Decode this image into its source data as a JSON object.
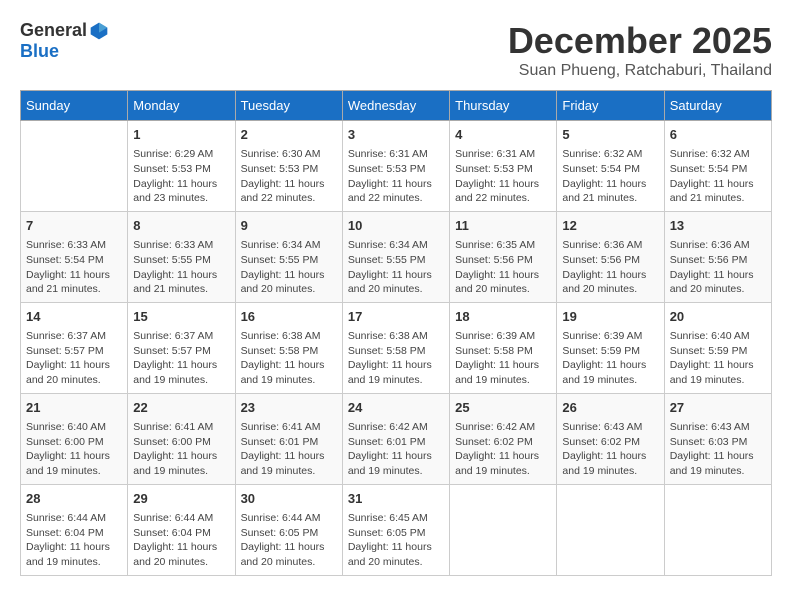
{
  "logo": {
    "general": "General",
    "blue": "Blue"
  },
  "title": "December 2025",
  "location": "Suan Phueng, Ratchaburi, Thailand",
  "days_header": [
    "Sunday",
    "Monday",
    "Tuesday",
    "Wednesday",
    "Thursday",
    "Friday",
    "Saturday"
  ],
  "weeks": [
    [
      {
        "day": "",
        "info": ""
      },
      {
        "day": "1",
        "info": "Sunrise: 6:29 AM\nSunset: 5:53 PM\nDaylight: 11 hours\nand 23 minutes."
      },
      {
        "day": "2",
        "info": "Sunrise: 6:30 AM\nSunset: 5:53 PM\nDaylight: 11 hours\nand 22 minutes."
      },
      {
        "day": "3",
        "info": "Sunrise: 6:31 AM\nSunset: 5:53 PM\nDaylight: 11 hours\nand 22 minutes."
      },
      {
        "day": "4",
        "info": "Sunrise: 6:31 AM\nSunset: 5:53 PM\nDaylight: 11 hours\nand 22 minutes."
      },
      {
        "day": "5",
        "info": "Sunrise: 6:32 AM\nSunset: 5:54 PM\nDaylight: 11 hours\nand 21 minutes."
      },
      {
        "day": "6",
        "info": "Sunrise: 6:32 AM\nSunset: 5:54 PM\nDaylight: 11 hours\nand 21 minutes."
      }
    ],
    [
      {
        "day": "7",
        "info": "Sunrise: 6:33 AM\nSunset: 5:54 PM\nDaylight: 11 hours\nand 21 minutes."
      },
      {
        "day": "8",
        "info": "Sunrise: 6:33 AM\nSunset: 5:55 PM\nDaylight: 11 hours\nand 21 minutes."
      },
      {
        "day": "9",
        "info": "Sunrise: 6:34 AM\nSunset: 5:55 PM\nDaylight: 11 hours\nand 20 minutes."
      },
      {
        "day": "10",
        "info": "Sunrise: 6:34 AM\nSunset: 5:55 PM\nDaylight: 11 hours\nand 20 minutes."
      },
      {
        "day": "11",
        "info": "Sunrise: 6:35 AM\nSunset: 5:56 PM\nDaylight: 11 hours\nand 20 minutes."
      },
      {
        "day": "12",
        "info": "Sunrise: 6:36 AM\nSunset: 5:56 PM\nDaylight: 11 hours\nand 20 minutes."
      },
      {
        "day": "13",
        "info": "Sunrise: 6:36 AM\nSunset: 5:56 PM\nDaylight: 11 hours\nand 20 minutes."
      }
    ],
    [
      {
        "day": "14",
        "info": "Sunrise: 6:37 AM\nSunset: 5:57 PM\nDaylight: 11 hours\nand 20 minutes."
      },
      {
        "day": "15",
        "info": "Sunrise: 6:37 AM\nSunset: 5:57 PM\nDaylight: 11 hours\nand 19 minutes."
      },
      {
        "day": "16",
        "info": "Sunrise: 6:38 AM\nSunset: 5:58 PM\nDaylight: 11 hours\nand 19 minutes."
      },
      {
        "day": "17",
        "info": "Sunrise: 6:38 AM\nSunset: 5:58 PM\nDaylight: 11 hours\nand 19 minutes."
      },
      {
        "day": "18",
        "info": "Sunrise: 6:39 AM\nSunset: 5:58 PM\nDaylight: 11 hours\nand 19 minutes."
      },
      {
        "day": "19",
        "info": "Sunrise: 6:39 AM\nSunset: 5:59 PM\nDaylight: 11 hours\nand 19 minutes."
      },
      {
        "day": "20",
        "info": "Sunrise: 6:40 AM\nSunset: 5:59 PM\nDaylight: 11 hours\nand 19 minutes."
      }
    ],
    [
      {
        "day": "21",
        "info": "Sunrise: 6:40 AM\nSunset: 6:00 PM\nDaylight: 11 hours\nand 19 minutes."
      },
      {
        "day": "22",
        "info": "Sunrise: 6:41 AM\nSunset: 6:00 PM\nDaylight: 11 hours\nand 19 minutes."
      },
      {
        "day": "23",
        "info": "Sunrise: 6:41 AM\nSunset: 6:01 PM\nDaylight: 11 hours\nand 19 minutes."
      },
      {
        "day": "24",
        "info": "Sunrise: 6:42 AM\nSunset: 6:01 PM\nDaylight: 11 hours\nand 19 minutes."
      },
      {
        "day": "25",
        "info": "Sunrise: 6:42 AM\nSunset: 6:02 PM\nDaylight: 11 hours\nand 19 minutes."
      },
      {
        "day": "26",
        "info": "Sunrise: 6:43 AM\nSunset: 6:02 PM\nDaylight: 11 hours\nand 19 minutes."
      },
      {
        "day": "27",
        "info": "Sunrise: 6:43 AM\nSunset: 6:03 PM\nDaylight: 11 hours\nand 19 minutes."
      }
    ],
    [
      {
        "day": "28",
        "info": "Sunrise: 6:44 AM\nSunset: 6:04 PM\nDaylight: 11 hours\nand 19 minutes."
      },
      {
        "day": "29",
        "info": "Sunrise: 6:44 AM\nSunset: 6:04 PM\nDaylight: 11 hours\nand 20 minutes."
      },
      {
        "day": "30",
        "info": "Sunrise: 6:44 AM\nSunset: 6:05 PM\nDaylight: 11 hours\nand 20 minutes."
      },
      {
        "day": "31",
        "info": "Sunrise: 6:45 AM\nSunset: 6:05 PM\nDaylight: 11 hours\nand 20 minutes."
      },
      {
        "day": "",
        "info": ""
      },
      {
        "day": "",
        "info": ""
      },
      {
        "day": "",
        "info": ""
      }
    ]
  ]
}
